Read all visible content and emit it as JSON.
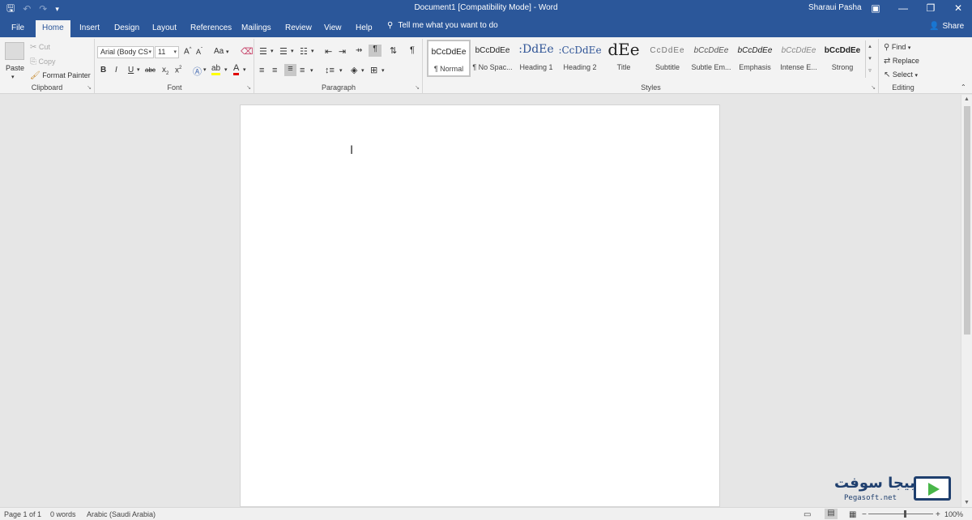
{
  "titlebar": {
    "document_title": "Document1 [Compatibility Mode] - Word",
    "user_name": "Sharaui Pasha",
    "quick_access": [
      "save-icon",
      "undo-icon",
      "redo-icon",
      "customize-icon"
    ]
  },
  "tabs": [
    "File",
    "Home",
    "Insert",
    "Design",
    "Layout",
    "References",
    "Mailings",
    "Review",
    "View",
    "Help"
  ],
  "active_tab": "Home",
  "tell_me": "Tell me what you want to do",
  "share_label": "Share",
  "clipboard": {
    "label": "Clipboard",
    "paste": "Paste",
    "cut": "Cut",
    "copy": "Copy",
    "format_painter": "Format Painter"
  },
  "font": {
    "label": "Font",
    "font_name": "Arial (Body CS",
    "font_size": "11",
    "grow": "A",
    "shrink": "A",
    "change_case": "Aa",
    "bold": "B",
    "italic": "I",
    "underline": "U",
    "strike": "abc",
    "subscript": "x",
    "superscript": "x",
    "font_color": "A"
  },
  "paragraph": {
    "label": "Paragraph",
    "pilcrow": "¶"
  },
  "styles": {
    "label": "Styles",
    "items": [
      {
        "sample": "bCcDdEe",
        "name": "¶ Normal"
      },
      {
        "sample": "bCcDdEe",
        "name": "¶ No Spac..."
      },
      {
        "sample": ":DdEe",
        "name": "Heading 1"
      },
      {
        "sample": ":CcDdEe",
        "name": "Heading 2"
      },
      {
        "sample": "dEe",
        "name": "Title"
      },
      {
        "sample": "CcDdEe",
        "name": "Subtitle"
      },
      {
        "sample": "bCcDdEe",
        "name": "Subtle Em..."
      },
      {
        "sample": "bCcDdEe",
        "name": "Emphasis"
      },
      {
        "sample": "bCcDdEe",
        "name": "Intense E..."
      },
      {
        "sample": "bCcDdEe",
        "name": "Strong"
      }
    ]
  },
  "editing": {
    "label": "Editing",
    "find": "Find",
    "replace": "Replace",
    "select": "Select"
  },
  "statusbar": {
    "page": "Page 1 of 1",
    "words": "0 words",
    "language": "Arabic (Saudi Arabia)",
    "zoom": "100%"
  },
  "watermark": {
    "arabic": "بيجا سوفت",
    "latin": "Pegasoft.net"
  },
  "colors": {
    "title_bar": "#2b579a",
    "ribbon": "#f3f3f3",
    "canvas": "#e6e6e6",
    "font_color_underline": "#e00000",
    "highlight_underline": "#ffff00"
  }
}
